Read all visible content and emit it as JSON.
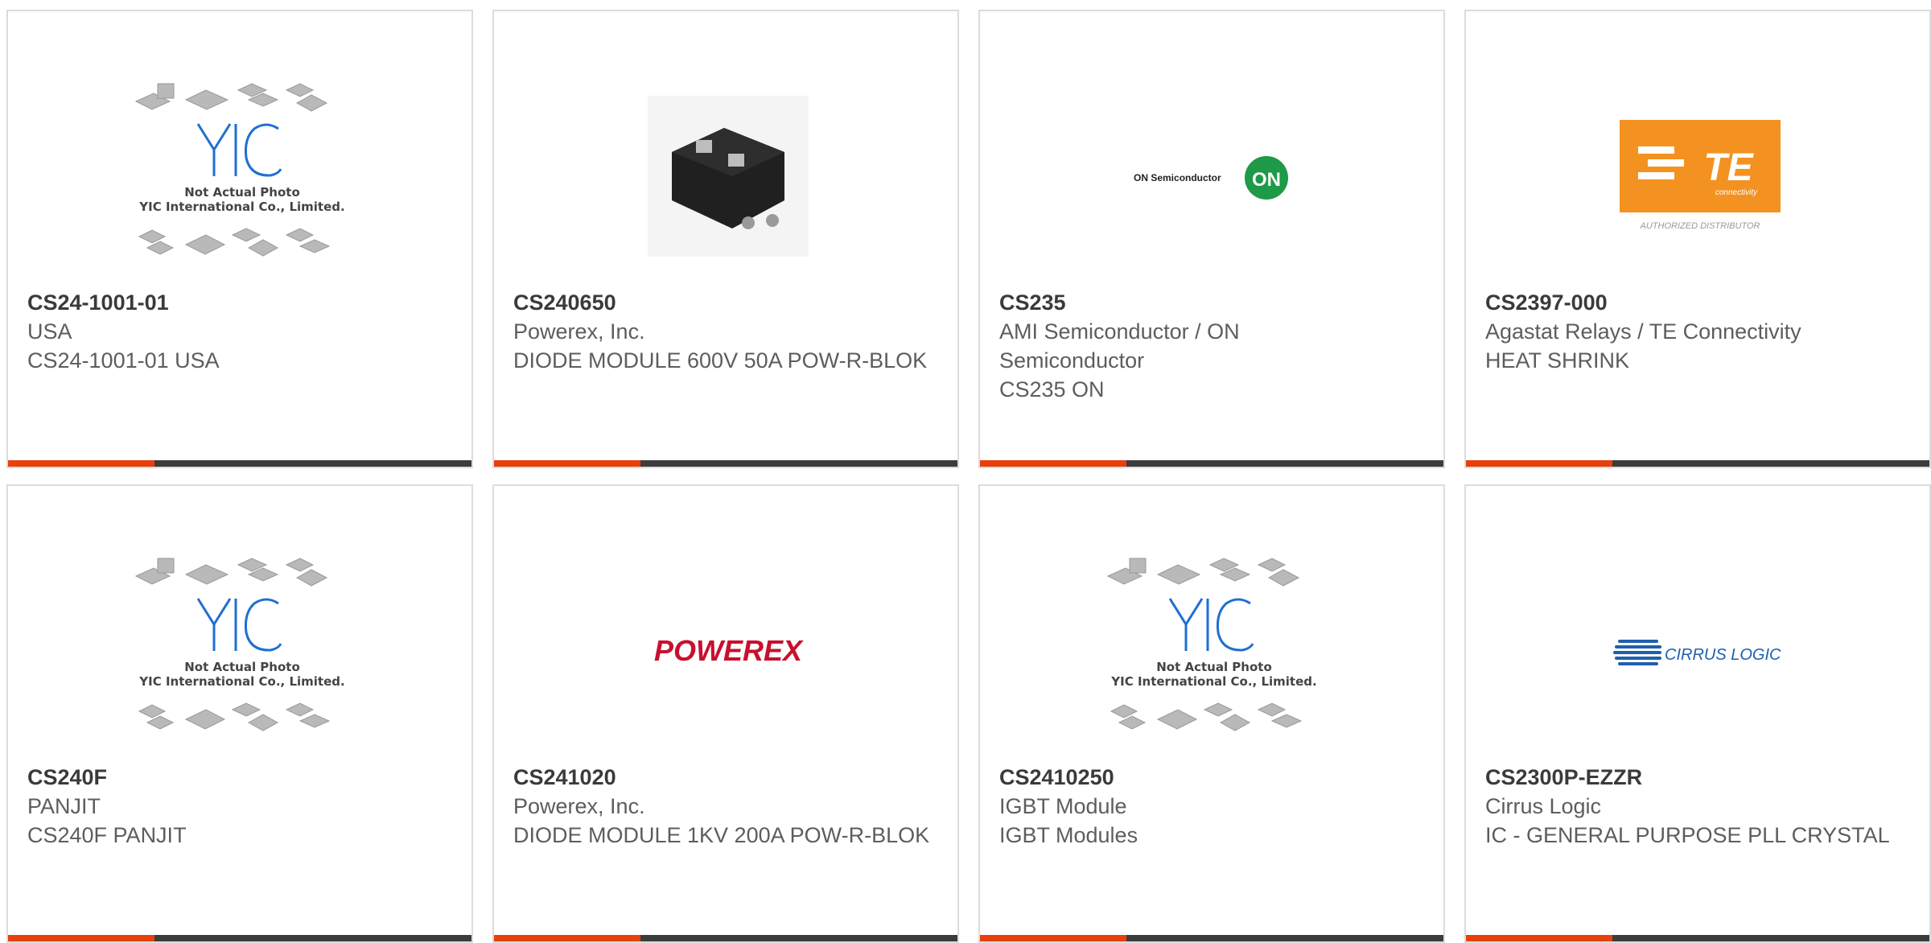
{
  "colors": {
    "accent": "#e8400c",
    "bar": "#3c3c3c",
    "border": "#dcdcdc",
    "text": "#5d5d5d"
  },
  "placeholder": {
    "brand": "YIC",
    "line1": "Not Actual Photo",
    "line2": "YIC International Co., Limited."
  },
  "logos": {
    "on_semi": {
      "text": "ON Semiconductor",
      "badge": "ON"
    },
    "te": {
      "mark": "TE",
      "sub": "connectivity",
      "tagline": "AUTHORIZED DISTRIBUTOR"
    },
    "powerex": {
      "text": "POWEREX"
    },
    "cirrus": {
      "text": "CIRRUS LOGIC"
    }
  },
  "products": [
    {
      "image": "placeholder",
      "part": "CS24-1001-01",
      "manufacturer": "USA",
      "description": "CS24-1001-01 USA"
    },
    {
      "image": "diode-module-photo",
      "part": "CS240650",
      "manufacturer": "Powerex, Inc.",
      "description": "DIODE MODULE 600V 50A POW-R-BLOK"
    },
    {
      "image": "on-semi-logo",
      "part": "CS235",
      "manufacturer": "AMI Semiconductor / ON Semiconductor",
      "description": "CS235 ON"
    },
    {
      "image": "te-logo",
      "part": "CS2397-000",
      "manufacturer": "Agastat Relays / TE Connectivity",
      "description": "HEAT SHRINK"
    },
    {
      "image": "placeholder",
      "part": "CS240F",
      "manufacturer": "PANJIT",
      "description": "CS240F PANJIT"
    },
    {
      "image": "powerex-logo",
      "part": "CS241020",
      "manufacturer": "Powerex, Inc.",
      "description": "DIODE MODULE 1KV 200A POW-R-BLOK"
    },
    {
      "image": "placeholder",
      "part": "CS2410250",
      "manufacturer": "IGBT Module",
      "description": "IGBT Modules"
    },
    {
      "image": "cirrus-logo",
      "part": "CS2300P-EZZR",
      "manufacturer": "Cirrus Logic",
      "description": "IC - GENERAL PURPOSE PLL CRYSTAL"
    }
  ]
}
